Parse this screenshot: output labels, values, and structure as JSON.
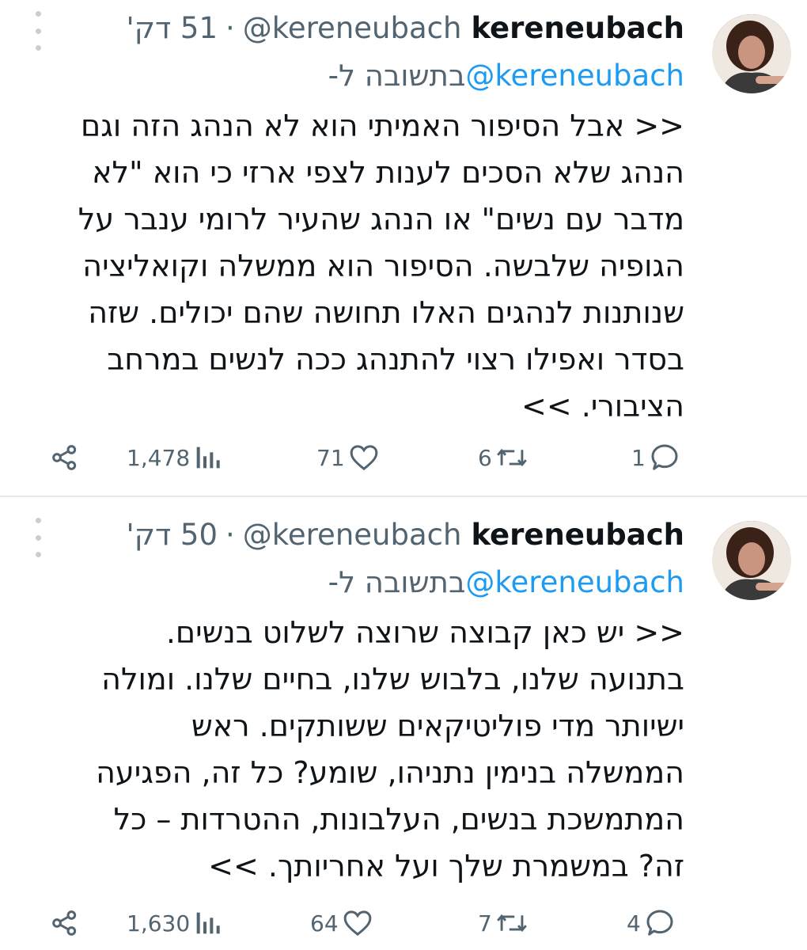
{
  "tweets": [
    {
      "display_name": "kereneubach",
      "handle": "@kereneubach",
      "separator": "·",
      "time": "51 דק'",
      "reply_prefix": "בתשובה ל-",
      "reply_handle": "@kereneubach",
      "body_lines": [
        "<< אבל הסיפור האמיתי הוא לא הנהג הזה וגם",
        "הנהג שלא הסכים לענות לצפי ארזי כי הוא \"לא",
        "מדבר עם נשים\" או הנהג שהעיר לרומי ענבר על",
        "הגופיה שלבשה. הסיפור הוא ממשלה וקואליציה",
        "שנותנות לנהגים האלו תחושה שהם יכולים. שזה",
        "בסדר ואפילו רצוי להתנהג ככה לנשים במרחב",
        "הציבורי. >>"
      ],
      "actions": {
        "replies": "1",
        "retweets": "6",
        "likes": "71",
        "views": "1,478"
      }
    },
    {
      "display_name": "kereneubach",
      "handle": "@kereneubach",
      "separator": "·",
      "time": "50 דק'",
      "reply_prefix": "בתשובה ל-",
      "reply_handle": "@kereneubach",
      "body_lines": [
        "<< יש כאן קבוצה שרוצה לשלוט בנשים.",
        "בתנועה שלנו, בלבוש שלנו, בחיים שלנו. ומולה",
        "ישיותר מדי פוליטיקאים ששותקים. ראש",
        "הממשלה בנימין נתניהו, שומע? כל זה, הפגיעה",
        "המתמשכת בנשים, העלבונות, ההטרדות – כל",
        "זה? במשמרת שלך ועל אחריותך. >>"
      ],
      "actions": {
        "replies": "4",
        "retweets": "7",
        "likes": "64",
        "views": "1,630"
      }
    }
  ],
  "icons": {
    "more": "more-vertical-icon",
    "reply": "reply-icon",
    "retweet": "retweet-icon",
    "like": "heart-icon",
    "views": "views-icon",
    "share": "share-icon"
  },
  "colors": {
    "text": "#0f1419",
    "secondary": "#536471",
    "link": "#1d9bf0",
    "divider": "#e7e9ea"
  }
}
